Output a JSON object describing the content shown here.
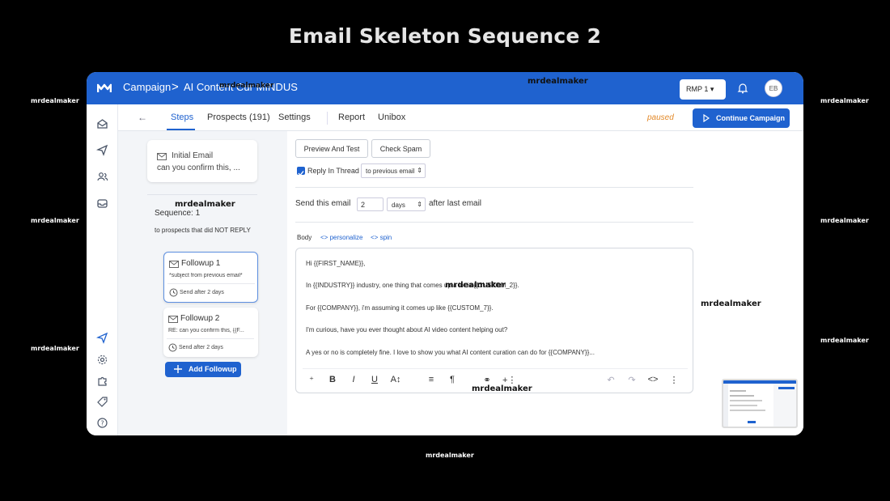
{
  "page_title": "Email Skeleton Sequence 2",
  "watermark": "mrdealmaker",
  "colors": {
    "brand": "#1f62cf",
    "paused": "#e38a2a",
    "panel_bg": "#f3f5f8"
  },
  "topbar": {
    "breadcrumb_root": "Campaign",
    "breadcrumb_sep": ">",
    "campaign_name": "AI Content Cur MINDUS",
    "account_select": "RMP 1",
    "avatar_initials": "EB",
    "icons": [
      "logo-icon",
      "bell-icon"
    ]
  },
  "sidebar": {
    "icons": [
      "inbox-icon",
      "send-icon",
      "users-icon",
      "tray-icon",
      "send-active-icon",
      "gear-icon",
      "puzzle-icon",
      "tag-icon",
      "help-icon"
    ]
  },
  "tabs": {
    "back": "←",
    "items": [
      "Steps",
      "Prospects (191)",
      "Settings",
      "Report",
      "Unibox"
    ],
    "active": "Steps",
    "status": "paused",
    "continue_label": "Continue Campaign"
  },
  "sequence": {
    "initial": {
      "title": "Initial Email",
      "subject": "can you confirm this, ..."
    },
    "title": "Sequence: 1",
    "description": "to prospects that did NOT REPLY",
    "followups": [
      {
        "title": "Followup 1",
        "subject": "*subject from previous email*",
        "after": "Send after 2 days"
      },
      {
        "title": "Followup 2",
        "subject": "RE: can you confirm this, {{F...",
        "after": "Send after 2 days"
      }
    ],
    "add_label": "Add Followup"
  },
  "editor": {
    "preview_label": "Preview And Test",
    "spam_label": "Check Spam",
    "reply_in_thread": "Reply In Thread",
    "thread_option": "to previous email",
    "send_prefix": "Send this email",
    "days_value": "2",
    "unit_value": "days",
    "send_suffix": "after last email",
    "body_label": "Body",
    "personalize": "<> personalize",
    "spin": "<> spin",
    "lines": [
      "Hi {{FIRST_NAME}},",
      "In {{INDUSTRY}} industry, one thing that comes up a lot is {{CUSTOM_2}}.",
      "For {{COMPANY}}, i'm assuming it comes up like {{CUSTOM_7}}.",
      "I'm curious, have you ever thought about AI video content helping out?",
      "A yes or no is completely fine. I love to show you what AI content curation can do for {{COMPANY}}..."
    ],
    "toolbar_icons": [
      "person-add-icon",
      "bold-icon",
      "italic-icon",
      "underline-icon",
      "text-size-icon",
      "align-icon",
      "paragraph-icon",
      "link-icon",
      "insert-icon",
      "undo-icon",
      "redo-icon",
      "code-icon",
      "more-icon"
    ],
    "toolbar_glyphs": [
      "⁺",
      "B",
      "I",
      "U",
      "A↕",
      "≡",
      "¶",
      "⚭",
      "+⋮",
      "↶",
      "↷",
      "<>",
      "⋮"
    ]
  }
}
